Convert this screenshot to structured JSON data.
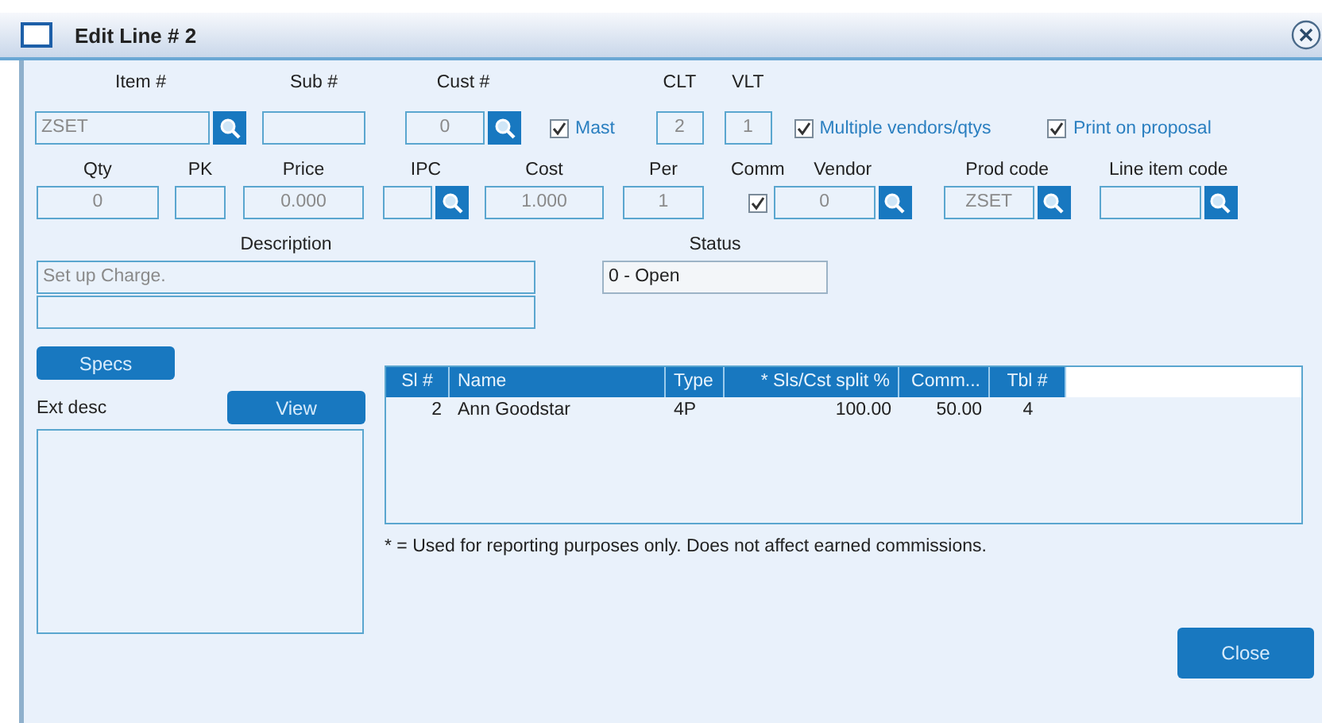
{
  "window": {
    "title": "Edit Line # 2"
  },
  "row_1": [
    {
      "kind": "lookup",
      "label": "Item #",
      "value": "ZSET"
    },
    {
      "kind": "field",
      "label": "Sub #"
    },
    {
      "kind": "lookup",
      "label": "Cust #",
      "value": "0"
    },
    {
      "kind": "check",
      "text": "Mast",
      "checked": true
    },
    {
      "kind": "field",
      "label": "CLT",
      "value": "2"
    },
    {
      "kind": "field",
      "label": "VLT",
      "value": "1"
    },
    {
      "kind": "check",
      "text": "Multiple vendors/qtys",
      "checked": true
    },
    {
      "kind": "check",
      "text": "Print on proposal",
      "checked": true
    }
  ],
  "row_2": [
    {
      "kind": "field",
      "label": "Qty",
      "value": "0"
    },
    {
      "kind": "field",
      "label": "PK"
    },
    {
      "kind": "field",
      "label": "Price",
      "value": "0.000"
    },
    {
      "kind": "lookup",
      "label": "IPC"
    },
    {
      "kind": "field",
      "label": "Cost",
      "value": "1.000"
    },
    {
      "kind": "field",
      "label": "Per",
      "value": "1"
    },
    {
      "kind": "check",
      "label": "Comm",
      "checked": true
    },
    {
      "kind": "lookup",
      "label": "Vendor",
      "value": "0"
    },
    {
      "kind": "lookup",
      "label": "Prod code",
      "value": "ZSET"
    },
    {
      "kind": "lookup",
      "label": "Line item code"
    }
  ],
  "description": {
    "label": "Description",
    "value": "Set up Charge."
  },
  "status": {
    "label": "Status",
    "value": "0 - Open"
  },
  "specs_button": "Specs",
  "ext_desc": {
    "label": "Ext desc",
    "button": "View"
  },
  "table": {
    "columns": [
      "Sl #",
      "Name",
      "Type",
      "* Sls/Cst split %",
      "Comm...",
      "Tbl #"
    ],
    "rows": [
      [
        "2",
        "Ann Goodstar",
        "4P",
        "100.00",
        "50.00",
        "4"
      ]
    ]
  },
  "footnote": "* = Used for reporting purposes only.  Does not affect earned commissions.",
  "buttons": [
    "Close"
  ]
}
